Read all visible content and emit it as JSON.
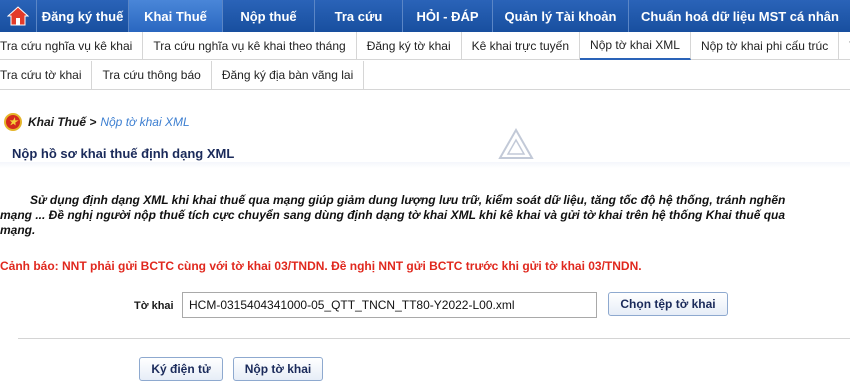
{
  "topnav": {
    "items": [
      {
        "label": "Đăng ký thuế"
      },
      {
        "label": "Khai Thuế"
      },
      {
        "label": "Nộp thuế"
      },
      {
        "label": "Tra cứu"
      },
      {
        "label": "HỎI - ĐÁP"
      },
      {
        "label": "Quản lý Tài khoản"
      },
      {
        "label": "Chuẩn hoá dữ liệu MST cá nhân"
      }
    ],
    "active": "Khai Thuế",
    "colors": {
      "bar": "#1f5aad",
      "active": "#3a78cf"
    }
  },
  "subnav": {
    "row1": [
      {
        "label": "Tra cứu nghĩa vụ kê khai"
      },
      {
        "label": "Tra cứu nghĩa vụ kê khai theo tháng"
      },
      {
        "label": "Đăng ký tờ khai"
      },
      {
        "label": "Kê khai trực tuyến"
      },
      {
        "label": "Nộp tờ khai XML"
      },
      {
        "label": "Nộp tờ khai phi cấu trúc"
      },
      {
        "label": "Trình"
      }
    ],
    "row2": [
      {
        "label": "Tra cứu tờ khai"
      },
      {
        "label": "Tra cứu thông báo"
      },
      {
        "label": "Đăng ký địa bàn vãng lai"
      }
    ],
    "active": "Nộp tờ khai XML"
  },
  "breadcrumb": {
    "root": "Khai Thuế >",
    "current": "Nộp tờ khai XML"
  },
  "page": {
    "title": "Nộp hồ sơ khai thuế định dạng XML",
    "intro_line1": "Sử dụng định dạng XML khi khai thuế qua mạng giúp giảm dung lượng lưu trữ, kiểm soát dữ liệu, tăng tốc độ hệ thống, tránh nghẽn",
    "intro_line2": "mạng ... Đề nghị người nộp thuế tích cực chuyển sang dùng định dạng tờ khai XML khi kê khai và gửi tờ khai trên hệ thống Khai thuế qua",
    "intro_line3": "mạng.",
    "warning": "Cảnh báo: NNT phải gửi BCTC cùng với tờ khai 03/TNDN. Đề nghị NNT gửi BCTC trước khi gửi tờ khai 03/TNDN.",
    "warning_color": "#e0281e"
  },
  "form": {
    "file_label": "Tờ khai",
    "file_value": "HCM-0315404341000-05_QTT_TNCN_TT80-Y2022-L00.xml",
    "choose_button": "Chọn tệp tờ khai",
    "sign_button": "Ký điện tử",
    "submit_button": "Nộp tờ khai"
  },
  "icons": {
    "home": "home-icon",
    "emblem": "national-emblem-icon",
    "watermark": "watermark-logo"
  }
}
